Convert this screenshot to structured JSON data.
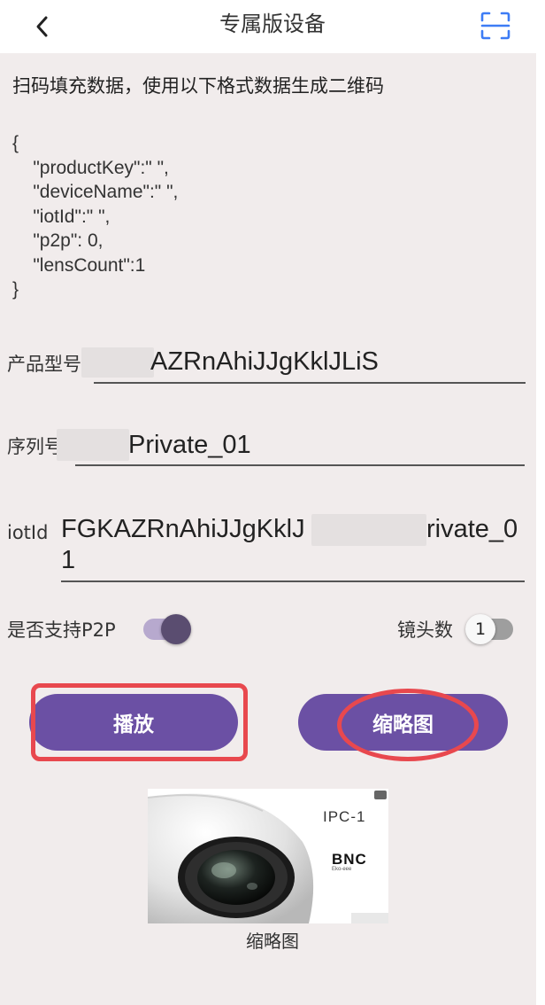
{
  "header": {
    "title": "专属版设备",
    "back_icon": "chevron-left-icon",
    "scan_icon": "scan-icon",
    "accent_color": "#3d7cf5"
  },
  "instruction": "扫码填充数据，使用以下格式数据生成二维码",
  "json_sample": "{\n    \"productKey\":\" \",\n    \"deviceName\":\" \",\n    \"iotId\":\" \",\n    \"p2p\": 0,\n    \"lensCount\":1\n}",
  "form": {
    "product_model": {
      "label": "产品型号",
      "value": "AZRnAhiJJgKklJLiS"
    },
    "serial_number": {
      "label": "序列号",
      "value": "Private_01"
    },
    "iot_id": {
      "label": "iotId",
      "value_line1": "FGKAZRnAhiJJgKklJ",
      "value_line1_end": "rivate_0",
      "value_line2": "1"
    }
  },
  "options": {
    "p2p": {
      "label": "是否支持P2P",
      "enabled": true
    },
    "lens_count": {
      "label": "镜头数",
      "value": "1",
      "enabled": false
    }
  },
  "buttons": {
    "play": "播放",
    "thumbnail": "缩略图"
  },
  "thumbnail": {
    "model_text": "IPC-1",
    "brand_text": "BNC",
    "brand_sub": "Eko-eee",
    "caption": "缩略图"
  },
  "colors": {
    "primary": "#6b50a4",
    "highlight": "#e8484e",
    "background": "#f1ecec"
  }
}
